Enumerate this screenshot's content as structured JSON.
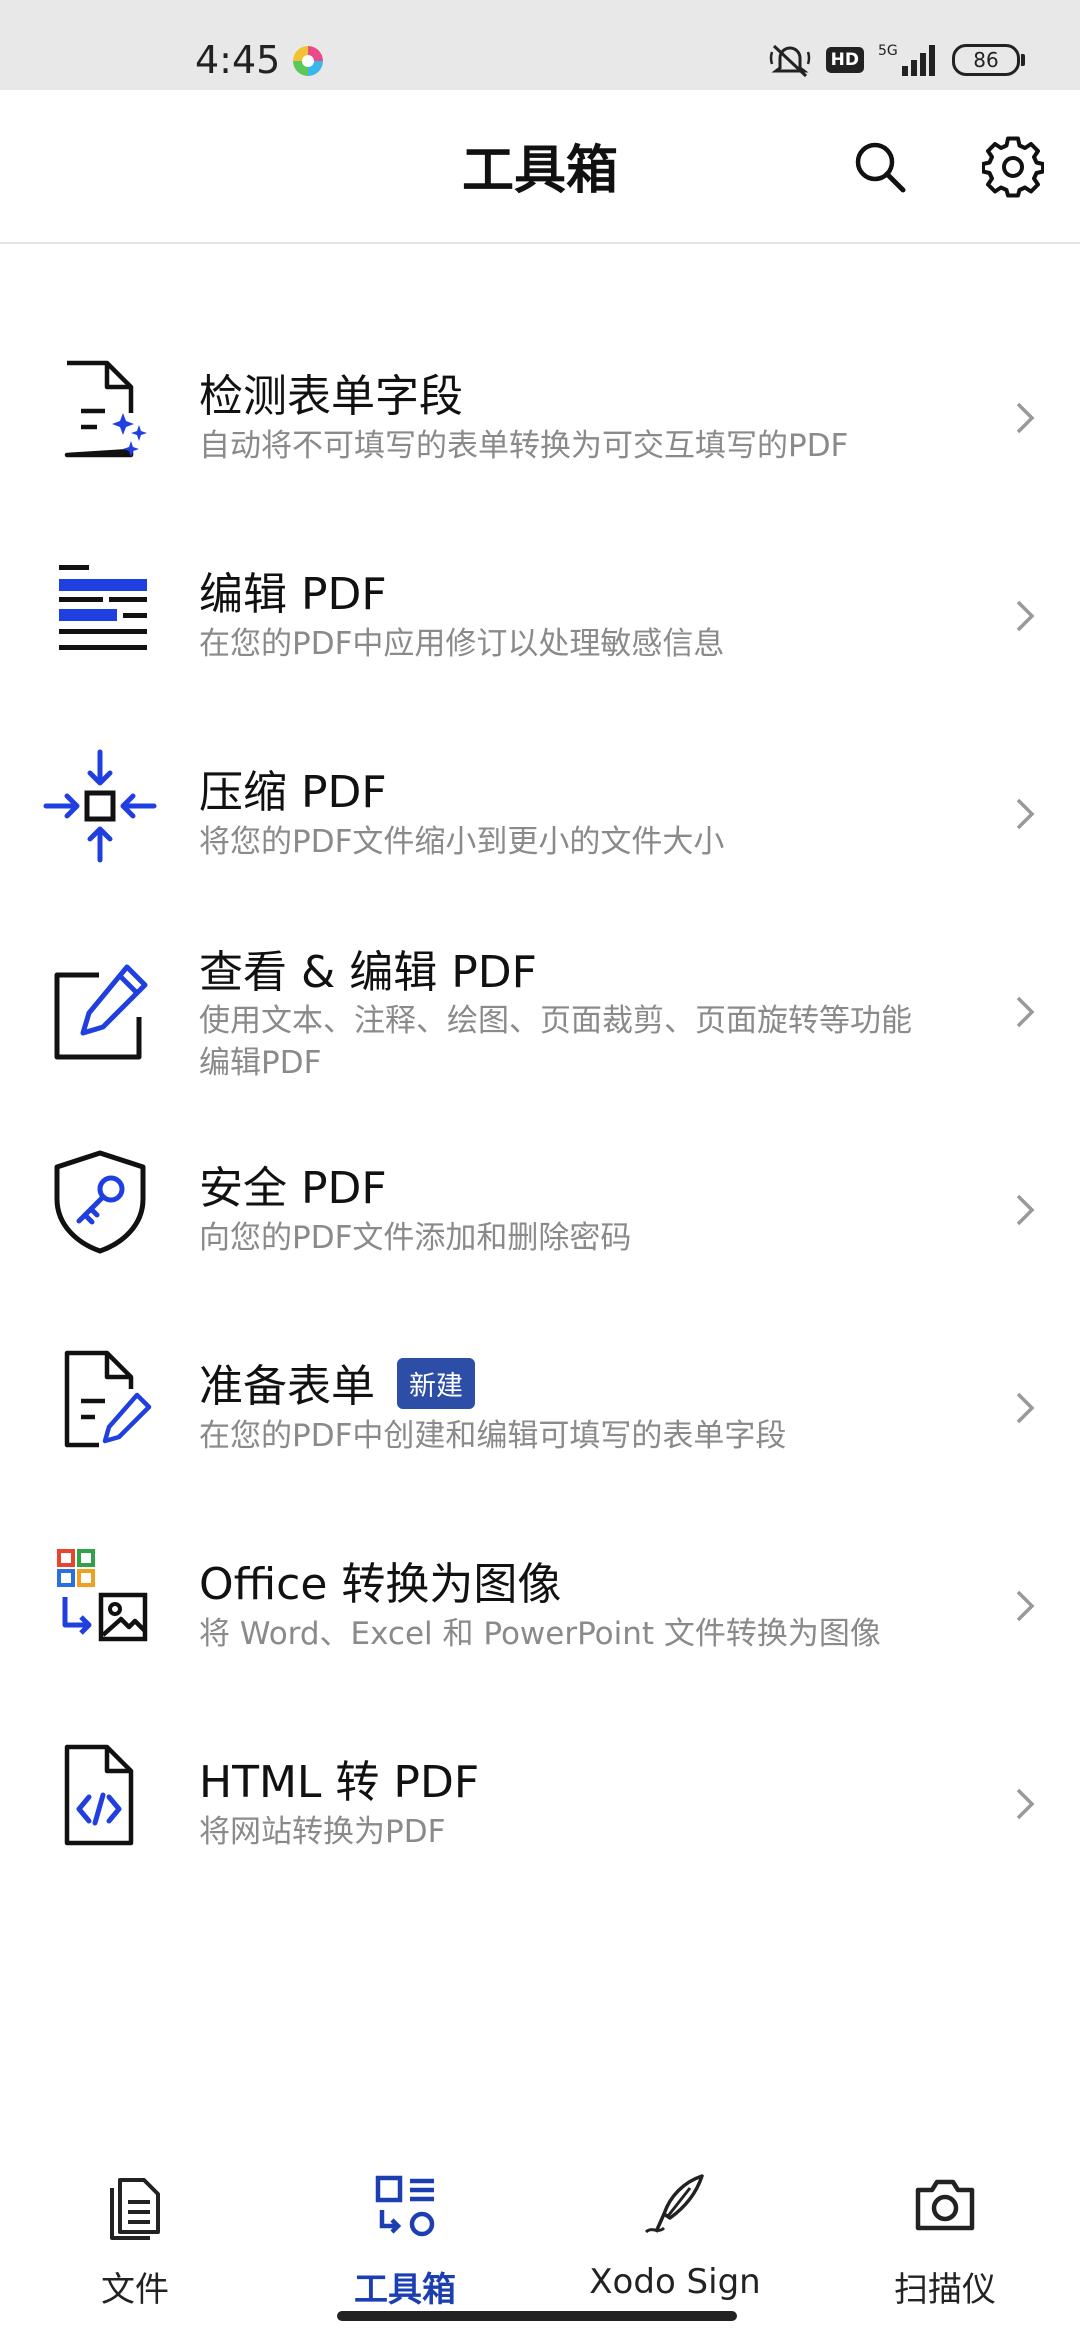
{
  "status_bar": {
    "time": "4:45",
    "network": "5G",
    "hd_label": "HD",
    "battery": "86"
  },
  "header": {
    "title": "工具箱"
  },
  "tools": [
    {
      "title": "检测表单字段",
      "desc": "自动将不可填写的表单转换为可交互填写的PDF",
      "icon": "detect-form-fields-icon"
    },
    {
      "title": "编辑 PDF",
      "desc": "在您的PDF中应用修订以处理敏感信息",
      "icon": "redact-icon"
    },
    {
      "title": "压缩 PDF",
      "desc": "将您的PDF文件缩小到更小的文件大小",
      "icon": "compress-icon"
    },
    {
      "title": "查看 & 编辑 PDF",
      "desc": "使用文本、注释、绘图、页面裁剪、页面旋转等功能编辑PDF",
      "icon": "view-edit-icon"
    },
    {
      "title": "安全 PDF",
      "desc": "向您的PDF文件添加和删除密码",
      "icon": "secure-shield-icon"
    },
    {
      "title": "准备表单",
      "badge": "新建",
      "desc": "在您的PDF中创建和编辑可填写的表单字段",
      "icon": "prepare-form-icon"
    },
    {
      "title": "Office 转换为图像",
      "desc": "将 Word、Excel 和 PowerPoint 文件转换为图像",
      "icon": "office-to-image-icon"
    },
    {
      "title": "HTML 转 PDF",
      "desc": "将网站转换为PDF",
      "icon": "html-file-icon"
    }
  ],
  "bottom_nav": [
    {
      "label": "文件",
      "icon": "files-icon",
      "active": false
    },
    {
      "label": "工具箱",
      "icon": "toolbox-icon",
      "active": true
    },
    {
      "label": "Xodo Sign",
      "icon": "sign-pen-icon",
      "active": false
    },
    {
      "label": "扫描仪",
      "icon": "camera-icon",
      "active": false
    }
  ],
  "colors": {
    "accent": "#1b3fb0",
    "icon_blue": "#1f3fe0",
    "badge": "#2c4ea6"
  }
}
